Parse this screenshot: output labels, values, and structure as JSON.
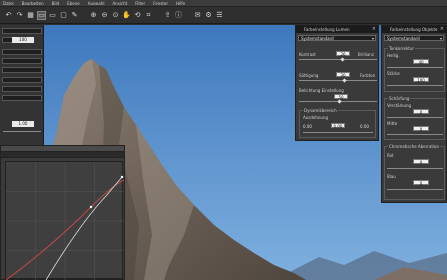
{
  "menu": [
    "Datei",
    "Bearbeiten",
    "Bild",
    "Ebene",
    "Auswahl",
    "Ansicht",
    "Filter",
    "Fenster",
    "Hilfe"
  ],
  "toolbar_icons": [
    "undo-icon",
    "redo-icon",
    "grid-icon",
    "window-icon",
    "window-icon",
    "window-icon",
    "paint-icon",
    "zoom-in-icon",
    "zoom-out-icon",
    "fit-icon",
    "hand-icon",
    "rotate-icon",
    "crop-icon",
    "export-icon",
    "info-icon",
    "chat-icon",
    "settings-icon"
  ],
  "left_panel": {
    "value_1": "100",
    "value_2": "1.00"
  },
  "panel_color": {
    "title": "Farbeinstellung Lumen",
    "preset": "Systemstandard",
    "brightness_label": "Kontrast",
    "brightness_value": "26",
    "brightness_right": "Brillianz",
    "saturation_label": "Sättigung",
    "saturation_value": "30",
    "saturation_right": "Farbton",
    "exposure_label": "Belichtung Einstellung",
    "exposure_value": "50",
    "dynamic_group": "Dynamikbereich",
    "dynamic_label": "Ausdehnung",
    "dynamic_left": "0.00",
    "dynamic_mid": "0.00",
    "dynamic_right": "0.00"
  },
  "panel_detail": {
    "title": "Farbeinstellung Objekte",
    "preset": "Systemstandard",
    "group1": "Tonkorrektur",
    "g1_label1": "Hellig.",
    "g1_val1": "40",
    "g1_label2": "Stärke",
    "g1_val2": "100",
    "group2": "Schärfung",
    "g2_label1": "Verstärkung",
    "g2_val1": "0",
    "g2_label2": "Mitte",
    "g2_val2": "0",
    "group3": "Chromatische Aberration",
    "g3_label1": "Rot",
    "g3_val1": "0",
    "g3_label2": "Blau",
    "g3_val2": "0"
  },
  "colors": {
    "sky": "#4f86c7",
    "rock": "#7b6e62",
    "panel_bg": "#3a3a3a",
    "curve_red": "#c24a4a",
    "curve_white": "#e0e0e0"
  }
}
